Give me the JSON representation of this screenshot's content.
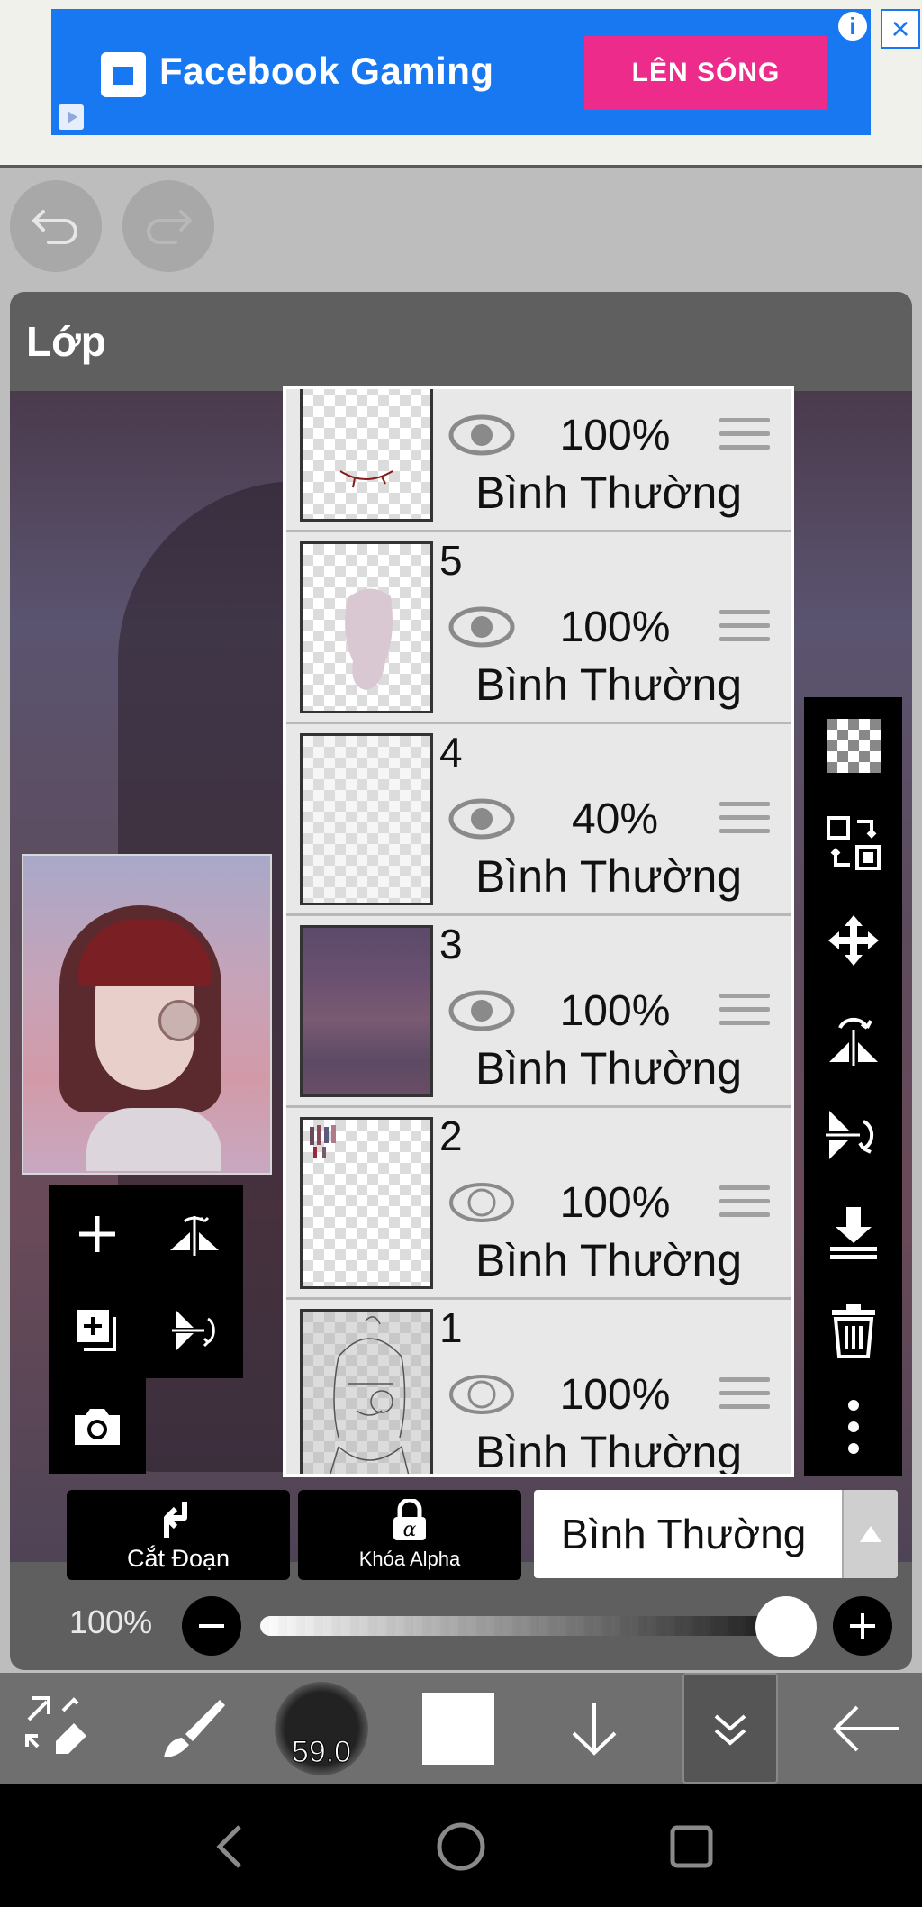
{
  "ad": {
    "brand": "Facebook Gaming",
    "cta": "LÊN SÓNG",
    "info_icon": "info-icon",
    "close_icon": "close-icon",
    "colors": {
      "background": "#1778f2",
      "cta": "#ec2b8a"
    }
  },
  "toolbar_top": {
    "undo_icon": "undo-icon",
    "redo_icon": "redo-icon"
  },
  "panel": {
    "title": "Lớp"
  },
  "layers": [
    {
      "number": "",
      "visible": true,
      "opacity": "100%",
      "blend": "Bình Thường"
    },
    {
      "number": "5",
      "visible": true,
      "opacity": "100%",
      "blend": "Bình Thường"
    },
    {
      "number": "4",
      "visible": true,
      "opacity": "40%",
      "blend": "Bình Thường"
    },
    {
      "number": "3",
      "visible": true,
      "opacity": "100%",
      "blend": "Bình Thường"
    },
    {
      "number": "2",
      "visible": false,
      "opacity": "100%",
      "blend": "Bình Thường"
    },
    {
      "number": "1",
      "visible": false,
      "opacity": "100%",
      "blend": "Bình Thường"
    }
  ],
  "left_tools": [
    "add-layer-icon",
    "flip-horizontal-icon",
    "copy-layer-icon",
    "flip-vertical-icon",
    "camera-icon"
  ],
  "right_tools": [
    "transparency-icon",
    "select-transform-icon",
    "move-icon",
    "flip-rotate-horizontal-icon",
    "flip-rotate-vertical-icon",
    "merge-down-icon",
    "trash-icon",
    "more-icon"
  ],
  "controls": {
    "clip_label": "Cắt Đoạn",
    "alpha_lock_label": "Khóa Alpha",
    "blend_mode": "Bình Thường",
    "opacity_label": "100%",
    "opacity_value": 1.0
  },
  "bottom_bar": {
    "brush_size": "59.0",
    "color": "#ffffff"
  }
}
